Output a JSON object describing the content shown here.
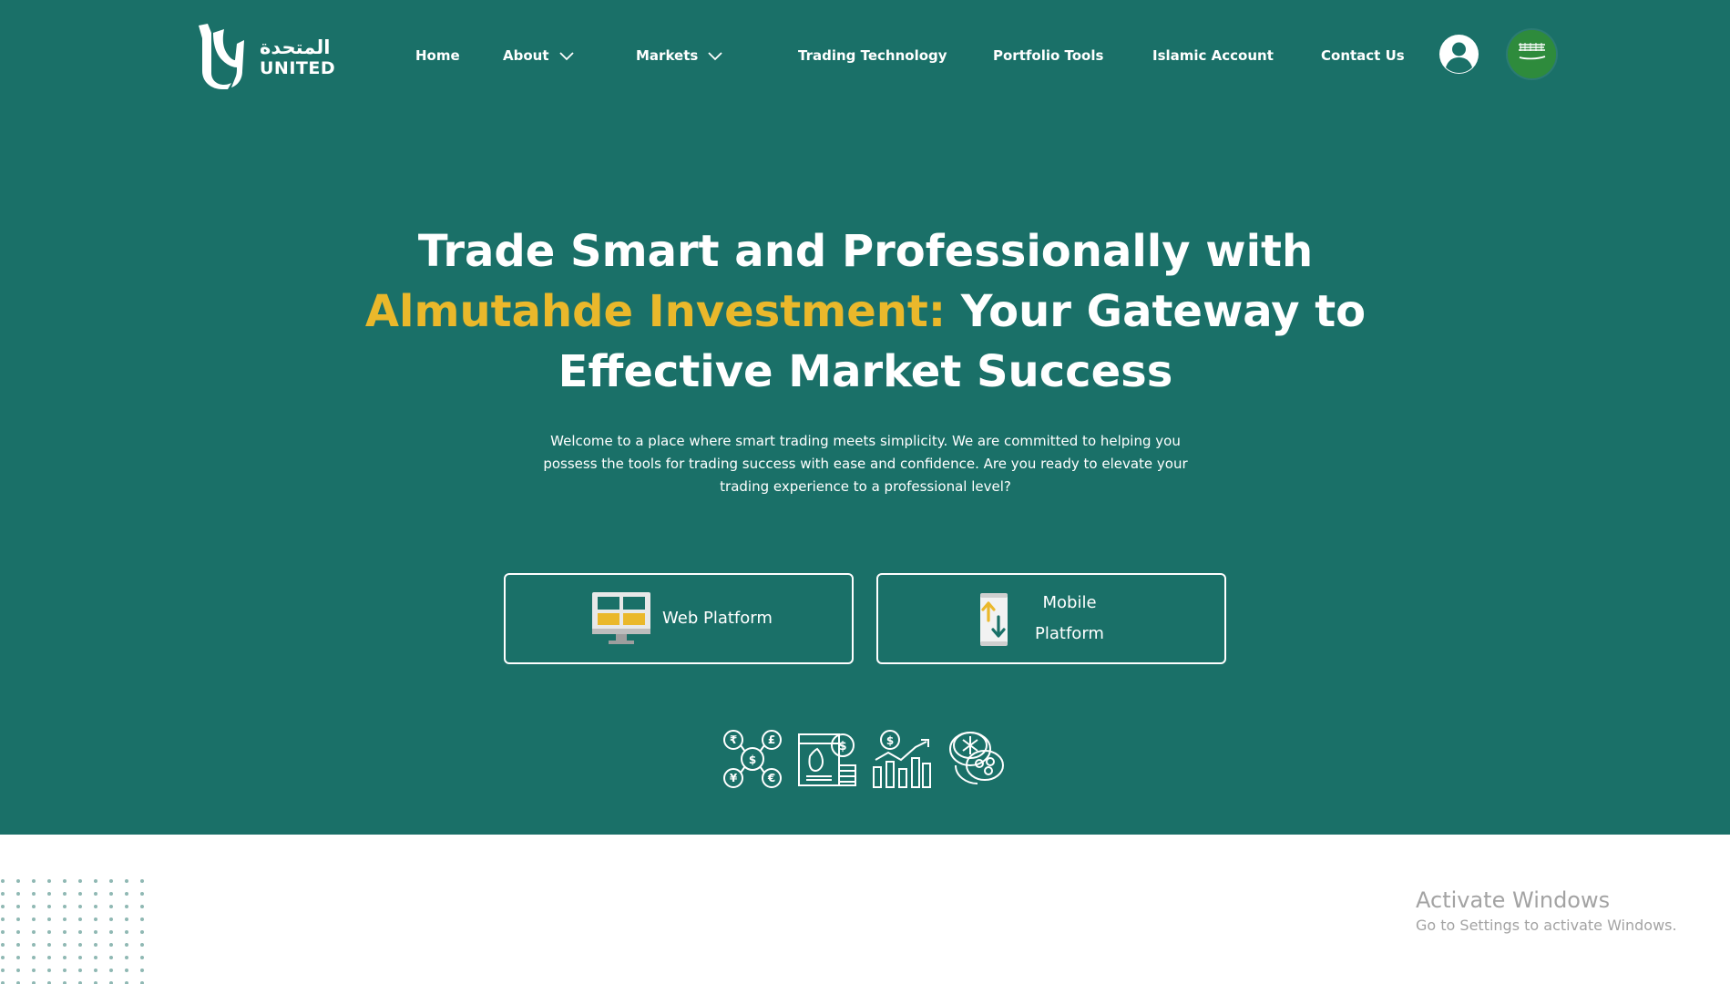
{
  "brand": {
    "name_ar": "المتحدة",
    "name_en": "UNITED"
  },
  "nav": {
    "items": [
      {
        "label": "Home",
        "dropdown": false
      },
      {
        "label": "About",
        "dropdown": true
      },
      {
        "label": "Markets",
        "dropdown": true
      },
      {
        "label": "Trading Technology",
        "dropdown": false
      },
      {
        "label": "Portfolio Tools",
        "dropdown": false
      },
      {
        "label": "Islamic Account",
        "dropdown": false
      },
      {
        "label": "Contact Us",
        "dropdown": false
      }
    ],
    "user_icon": "user-circle-icon",
    "language_icon": "saudi-flag-icon"
  },
  "hero": {
    "headline_part1": "Trade Smart and Professionally with",
    "headline_accent": "Almutahde Investment:",
    "headline_part2": "Your Gateway to",
    "headline_part3": "Effective Market Success",
    "intro_line1": "Welcome to a place where smart trading meets simplicity. We are committed to helping you",
    "intro_line2": "possess the tools for trading success with ease and confidence. Are you ready to elevate your",
    "intro_line3": "trading experience to a professional level?",
    "buttons": {
      "web": {
        "label": "Web Platform",
        "icon": "desktop-monitor-icon"
      },
      "mobile": {
        "label_line1": "Mobile",
        "label_line2": "Platform",
        "icon": "mobile-transfer-icon"
      }
    },
    "feature_icons": [
      "currency-exchange-icon",
      "commodities-icon",
      "stock-growth-icon",
      "crypto-coins-icon"
    ]
  },
  "watermark": {
    "title": "Activate Windows",
    "subtitle": "Go to Settings to activate Windows."
  },
  "colors": {
    "hero_bg": "#1a7068",
    "accent": "#eab82b",
    "text_light": "#ffffff"
  }
}
